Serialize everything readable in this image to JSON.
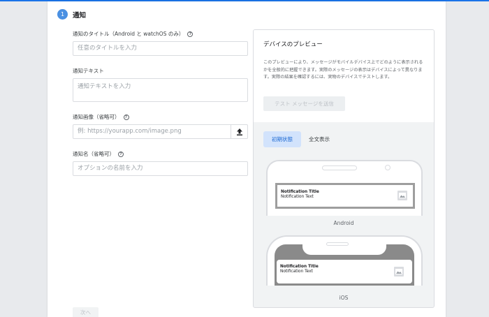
{
  "step": {
    "number": "1",
    "title": "通知"
  },
  "fields": {
    "title": {
      "label": "通知のタイトル（Android と watchOS のみ）",
      "placeholder": "任意のタイトルを入力"
    },
    "text": {
      "label": "通知テキスト",
      "placeholder": "通知テキストを入力"
    },
    "image": {
      "label": "通知画像（省略可）",
      "placeholder": "例: https://yourapp.com/image.png"
    },
    "name": {
      "label": "通知名（省略可）",
      "placeholder": "オプションの名前を入力"
    }
  },
  "help_icon_glyph": "?",
  "next_label": "次へ",
  "preview": {
    "title": "デバイスのプレビュー",
    "description": "このプレビューにより、メッセージがモバイルデバイス上でどのように表示されるかを全般的に把握できます。実際のメッセージの表示はデバイスによって異なります。実際の結果を確認するには、実物のデバイスでテストします。",
    "test_button": "テスト メッセージを送信",
    "tabs": [
      {
        "label": "初期状態",
        "active": true
      },
      {
        "label": "全文表示",
        "active": false
      }
    ],
    "android": {
      "label": "Android",
      "notification_title": "Notification Title",
      "notification_text": "Notification Text"
    },
    "ios": {
      "label": "iOS",
      "notification_title": "Notification Title",
      "notification_text": "Notification Text"
    }
  },
  "colors": {
    "accent": "#1a73e8",
    "step_badge": "#4a90e2",
    "active_tab_bg": "#d2e3fc",
    "active_tab_text": "#1967d2"
  }
}
